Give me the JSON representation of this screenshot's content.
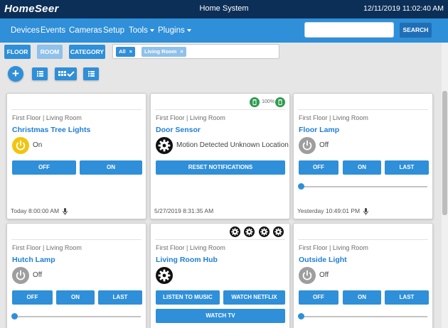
{
  "topbar": {
    "logo": "HomeSeer",
    "title": "Home System",
    "datetime": "12/11/2019 11:02:40 AM"
  },
  "nav": {
    "items": [
      "Devices",
      "Events",
      "Cameras",
      "Setup",
      "Tools",
      "Plugins"
    ],
    "search_placeholder": "",
    "search_button": "SEARCH"
  },
  "filters": {
    "buttons": [
      "FLOOR",
      "ROOM",
      "CATEGORY"
    ],
    "chips": [
      "All",
      "Living Room"
    ]
  },
  "colors": {
    "primary": "#2f8fd8",
    "dark": "#0c2f57",
    "link": "#1f7ed4",
    "on": "#f1c40f",
    "off": "#9e9e9e",
    "battery": "#2e9c4f"
  },
  "cards": [
    {
      "location": "First Floor | Living Room",
      "name": "Christmas Tree Lights",
      "status": "On",
      "icon": "power-on-icon",
      "buttons": [
        "OFF",
        "ON"
      ],
      "footer": "Today 8:00:00 AM"
    },
    {
      "location": "First Floor | Living Room",
      "name": "Door Sensor",
      "status": "Motion Detected Unknown Location",
      "icon": "gear-icon",
      "battery": "100%",
      "buttons": [
        "RESET NOTIFICATIONS"
      ],
      "footer": "5/27/2019 8:31:35 AM"
    },
    {
      "location": "First Floor | Living Room",
      "name": "Floor Lamp",
      "status": "Off",
      "icon": "power-off-icon",
      "buttons": [
        "OFF",
        "ON",
        "LAST"
      ],
      "slider_level": 0,
      "footer": "Yesterday 10:49:01 PM"
    },
    {
      "location": "First Floor | Living Room",
      "name": "Hutch Lamp",
      "status": "Off",
      "icon": "power-off-icon",
      "buttons": [
        "OFF",
        "ON",
        "LAST"
      ],
      "slider_level": 0
    },
    {
      "location": "First Floor | Living Room",
      "name": "Living Room Hub",
      "icon": "gear-icon",
      "buttons": [
        "LISTEN TO MUSIC",
        "WATCH NETFLIX",
        "WATCH TV"
      ]
    },
    {
      "location": "First Floor | Living Room",
      "name": "Outside Light",
      "status": "Off",
      "icon": "power-off-icon",
      "buttons": [
        "OFF",
        "ON",
        "LAST"
      ],
      "slider_level": 0
    }
  ]
}
